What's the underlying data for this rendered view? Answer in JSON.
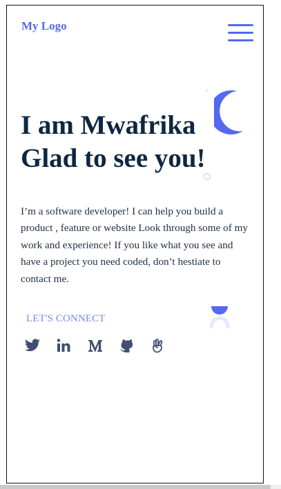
{
  "header": {
    "logo": "My Logo",
    "menu_icon": "hamburger-menu-icon"
  },
  "hero": {
    "headline_line1": "I am Mwafrika",
    "headline_line2": "Glad to see you!",
    "intro": "I’m a software developer! I can help you build a product , feature or website Look through some of my work and experience! If you like what you see and have a project you need coded, don’t hestiate to contact me."
  },
  "connect": {
    "label": "LET'S CONNECT",
    "socials": [
      {
        "icon": "twitter-icon"
      },
      {
        "icon": "linkedin-icon"
      },
      {
        "icon": "medium-icon"
      },
      {
        "icon": "github-icon"
      },
      {
        "icon": "angellist-icon"
      }
    ]
  },
  "colors": {
    "accent": "#5468f0",
    "heading": "#0f2740",
    "body_text": "#1f2f45",
    "connect_text": "#7b88e8",
    "icon": "#3f5070",
    "deco_light": "#e4e8ff"
  }
}
